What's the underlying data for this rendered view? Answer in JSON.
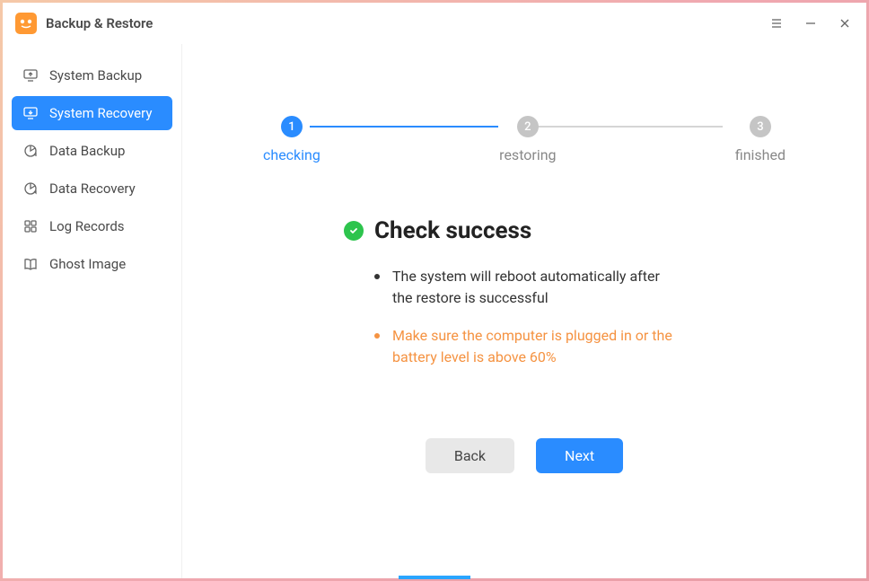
{
  "app": {
    "title": "Backup & Restore"
  },
  "sidebar": {
    "items": [
      {
        "label": "System Backup",
        "icon": "monitor-up-icon"
      },
      {
        "label": "System Recovery",
        "icon": "monitor-down-icon"
      },
      {
        "label": "Data Backup",
        "icon": "pie-up-icon"
      },
      {
        "label": "Data Recovery",
        "icon": "pie-down-icon"
      },
      {
        "label": "Log Records",
        "icon": "grid-icon"
      },
      {
        "label": "Ghost Image",
        "icon": "book-icon"
      }
    ],
    "active_index": 1
  },
  "stepper": {
    "steps": [
      {
        "num": "1",
        "label": "checking",
        "state": "active"
      },
      {
        "num": "2",
        "label": "restoring",
        "state": "inactive"
      },
      {
        "num": "3",
        "label": "finished",
        "state": "inactive"
      }
    ]
  },
  "content": {
    "heading": "Check success",
    "bullets": [
      {
        "text": "The system will reboot automatically after the restore is successful",
        "style": "dark"
      },
      {
        "text": "Make sure the computer is plugged in or the battery level is above 60%",
        "style": "orange"
      }
    ]
  },
  "buttons": {
    "back": "Back",
    "next": "Next"
  }
}
